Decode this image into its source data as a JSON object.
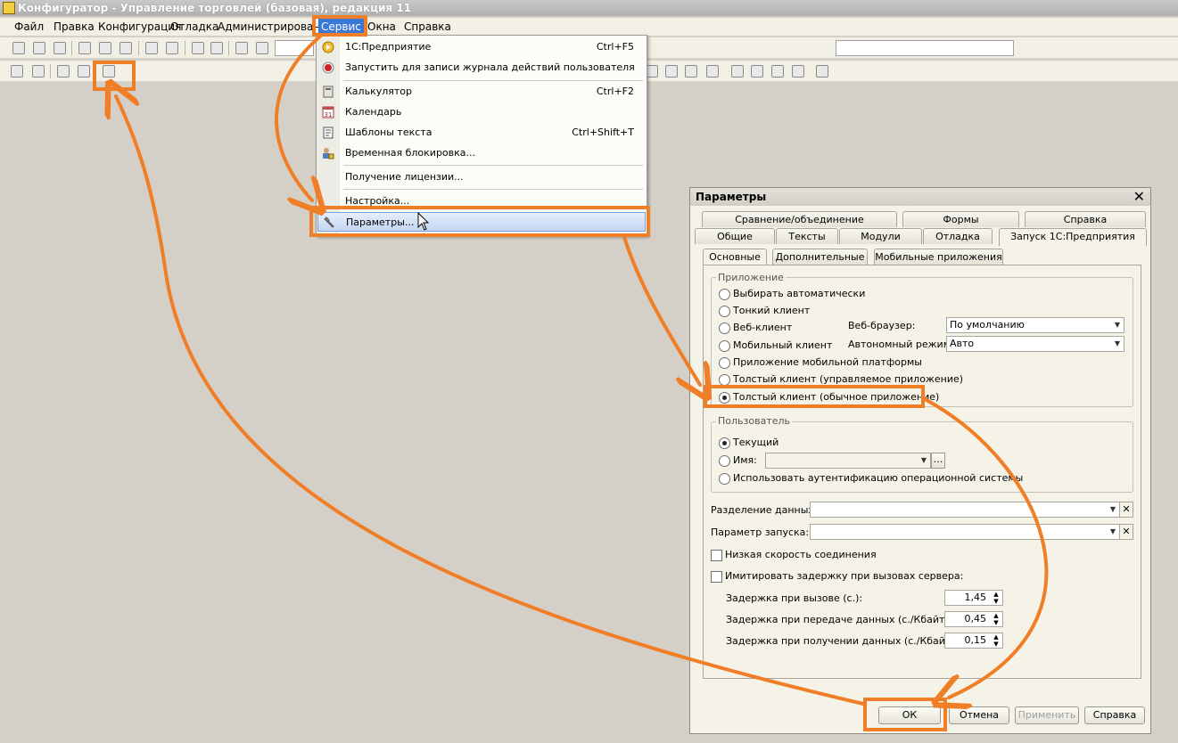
{
  "window": {
    "title": "Конфигуратор - Управление торговлей (базовая), редакция 11"
  },
  "menubar": {
    "items": [
      "Файл",
      "Правка",
      "Конфигурация",
      "Отладка",
      "Администрирование",
      "Сервис",
      "Окна",
      "Справка"
    ]
  },
  "service_menu": {
    "items": [
      {
        "label": "1С:Предприятие",
        "shortcut": "Ctrl+F5",
        "icon": "play-icon"
      },
      {
        "label": "Запустить для записи журнала действий пользователя",
        "shortcut": "",
        "icon": "record-icon"
      },
      {
        "label": "Калькулятор",
        "shortcut": "Ctrl+F2",
        "icon": "calculator-icon"
      },
      {
        "label": "Календарь",
        "shortcut": "",
        "icon": "calendar-icon"
      },
      {
        "label": "Шаблоны текста",
        "shortcut": "Ctrl+Shift+T",
        "icon": "template-icon"
      },
      {
        "label": "Временная блокировка...",
        "shortcut": "",
        "icon": "lock-user-icon"
      },
      {
        "label": "Получение лицензии...",
        "shortcut": "",
        "icon": ""
      },
      {
        "label": "Настройка...",
        "shortcut": "",
        "icon": ""
      },
      {
        "label": "Параметры...",
        "shortcut": "",
        "icon": "wrench-icon"
      }
    ],
    "calendar_icon_text": "31"
  },
  "dialog": {
    "title": "Параметры",
    "tabs_row1": [
      "Сравнение/объединение",
      "Формы",
      "Справка"
    ],
    "tabs_row2": [
      "Общие",
      "Тексты",
      "Модули",
      "Отладка",
      "Запуск 1С:Предприятия"
    ],
    "subtabs": [
      "Основные",
      "Дополнительные",
      "Мобильные приложения"
    ],
    "app_group": {
      "legend": "Приложение",
      "options": [
        "Выбирать автоматически",
        "Тонкий клиент",
        "Веб-клиент",
        "Мобильный клиент",
        "Приложение мобильной платформы",
        "Толстый клиент (управляемое приложение)",
        "Толстый клиент (обычное приложение)"
      ],
      "selected_index": 6,
      "browser_label": "Веб-браузер:",
      "browser_value": "По умолчанию",
      "offline_label": "Автономный режим:",
      "offline_value": "Авто"
    },
    "user_group": {
      "legend": "Пользователь",
      "options": [
        "Текущий",
        "Имя:",
        "Использовать аутентификацию операционной системы"
      ],
      "selected_index": 0,
      "name_value": ""
    },
    "data_separation_label": "Разделение данных:",
    "data_separation_value": "",
    "launch_param_label": "Параметр запуска:",
    "launch_param_value": "",
    "low_speed_label": "Низкая скорость соединения",
    "low_speed_checked": false,
    "emulate_delay_label": "Имитировать задержку при вызовах сервера:",
    "emulate_delay_checked": false,
    "delays": [
      {
        "label": "Задержка при вызове (с.):",
        "value": "1,45"
      },
      {
        "label": "Задержка при передаче данных (с./Кбайт):",
        "value": "0,45"
      },
      {
        "label": "Задержка при получении данных (с./Кбайт):",
        "value": "0,15"
      }
    ],
    "buttons": {
      "ok": "ОК",
      "cancel": "Отмена",
      "apply": "Применить",
      "help": "Справка"
    }
  },
  "colors": {
    "highlight": "#f07e26",
    "menu_active": "#3a78d6"
  }
}
